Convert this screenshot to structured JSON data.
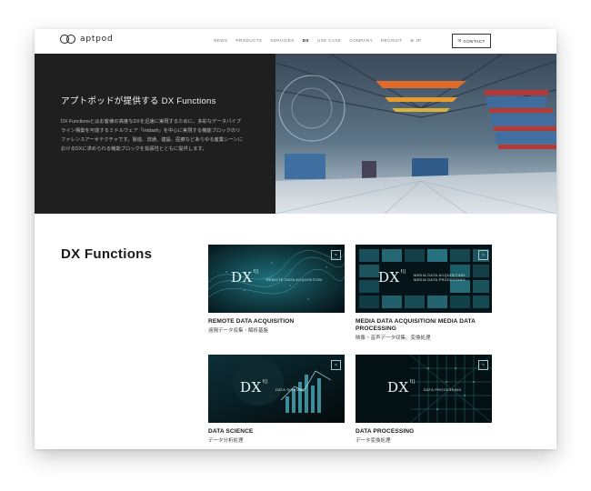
{
  "header": {
    "logo_text": "aptpod",
    "nav": [
      "NEWS",
      "PRODUCTS",
      "SERVICES",
      "DX",
      "USE CASE",
      "COMPANY",
      "RECRUIT"
    ],
    "nav_active": "DX",
    "lang": "JP",
    "contact_label": "CONTACT"
  },
  "hero": {
    "title": "アプトポッドが提供する DX Functions",
    "body": "DX Functionsとはお客様の高度なDXを迅速に実現するために、多彩なデータパイプライン構築を可能するミドルウェア「Intdash」を中心に実現する機能ブロックのリファレンスアーキテクチャです。製造、流通、建設、医療などあらゆる産業シーンにおけるDXに求められる機能ブロックを拡張性とともに提供します。"
  },
  "section": {
    "title": "DX Functions"
  },
  "cards": [
    {
      "dx": "DX",
      "sup": "f()",
      "overlay": "REMOTE DATA ACQUISITION",
      "badge": "f()",
      "title": "REMOTE DATA ACQUISITION",
      "subtitle": "遠隔データ収集・解析基盤"
    },
    {
      "dx": "DX",
      "sup": "f()",
      "overlay": "MEDIA DATA ACQUISITION\nMEDIA DATA PROCESSING",
      "badge": "f()",
      "title": "MEDIA DATA ACQUISITION/ MEDIA DATA PROCESSING",
      "subtitle": "映像・音声データ収集、変換処理"
    },
    {
      "dx": "DX",
      "sup": "f()",
      "overlay": "DATA SCIENCE",
      "badge": "f()",
      "title": "DATA SCIENCE",
      "subtitle": "データ分析処理"
    },
    {
      "dx": "DX",
      "sup": "f()",
      "overlay": "DATA PROCESSING",
      "badge": "f()",
      "title": "DATA PROCESSING",
      "subtitle": "データ変換処理"
    }
  ]
}
